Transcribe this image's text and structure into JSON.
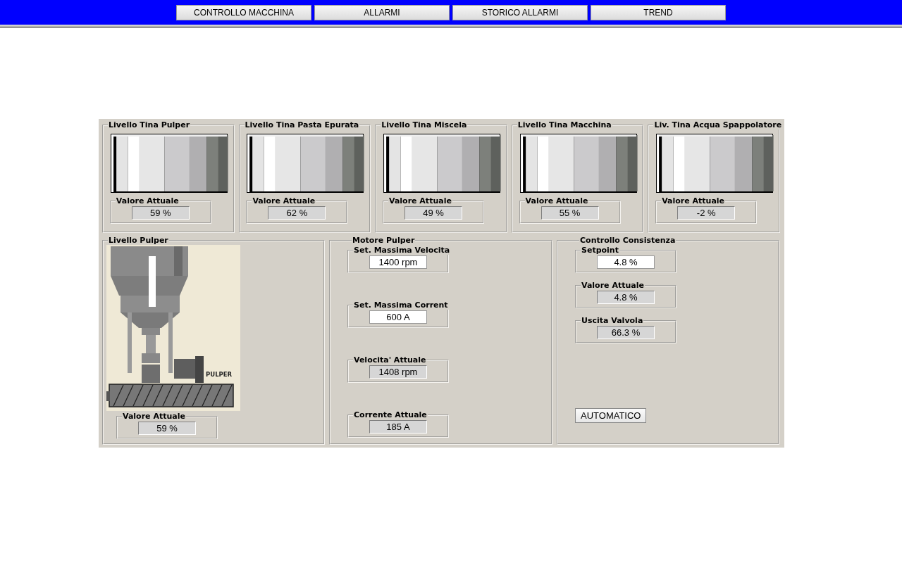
{
  "nav": [
    {
      "label": "CONTROLLO MACCHINA"
    },
    {
      "label": "ALLARMI"
    },
    {
      "label": "STORICO ALLARMI"
    },
    {
      "label": "TREND"
    }
  ],
  "tanks": [
    {
      "title": "Livello Tina Pulper",
      "field": {
        "label": "Valore Attuale",
        "value": "59 %",
        "kind": "reading"
      }
    },
    {
      "title": "Livello Tina Pasta Epurata",
      "field": {
        "label": "Valore Attuale",
        "value": "62 %",
        "kind": "reading"
      }
    },
    {
      "title": "Livello Tina Miscela",
      "field": {
        "label": "Valore Attuale",
        "value": "49 %",
        "kind": "reading"
      }
    },
    {
      "title": "Livello Tina Macchina",
      "field": {
        "label": "Valore Attuale",
        "value": "55 %",
        "kind": "reading"
      }
    },
    {
      "title": "Liv. Tina Acqua Spappolatore",
      "field": {
        "label": "Valore Attuale",
        "value": "-2 %",
        "kind": "reading"
      }
    }
  ],
  "pulper": {
    "title": "Livello Pulper",
    "image_label": "PULPER",
    "field": {
      "label": "Valore Attuale",
      "value": "59 %",
      "kind": "reading"
    }
  },
  "motor": {
    "title": "Motore Pulper",
    "fields": [
      {
        "label": "Set. Massima Velocita",
        "value": "1400 rpm",
        "kind": "setpoint"
      },
      {
        "label": "Set. Massima Corrent",
        "value": "600 A",
        "kind": "setpoint"
      },
      {
        "label": "Velocita' Attuale",
        "value": "1408 rpm",
        "kind": "reading"
      },
      {
        "label": "Corrente Attuale",
        "value": "185 A",
        "kind": "reading"
      }
    ]
  },
  "consistency": {
    "title": "Controllo Consistenza",
    "fields": [
      {
        "label": "Setpoint",
        "value": "4.8 %",
        "kind": "setpoint"
      },
      {
        "label": "Valore Attuale",
        "value": "4.8 %",
        "kind": "reading"
      },
      {
        "label": "Uscita Valvola",
        "value": "66.3 %",
        "kind": "reading"
      }
    ],
    "button": "AUTOMATICO"
  }
}
